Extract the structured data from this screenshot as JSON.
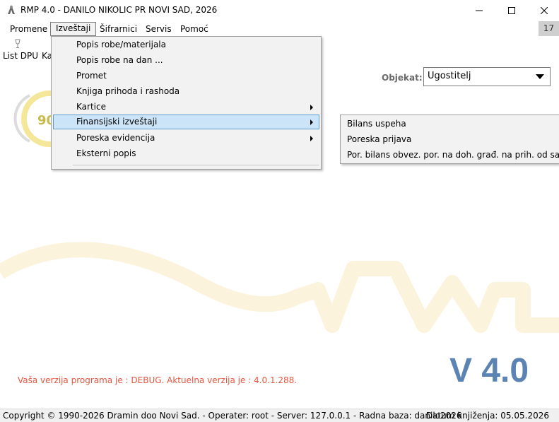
{
  "window": {
    "title": "RMP 4.0 - DANILO NIKOLIC PR NOVI SAD, 2026",
    "minimize_icon": "minimize-icon",
    "maximize_icon": "maximize-icon",
    "close_icon": "close-icon"
  },
  "menubar": {
    "items": [
      "Promene",
      "Izveštaji",
      "Šifrarnici",
      "Servis",
      "Pomoć"
    ],
    "active": "Izveštaji",
    "count": "17"
  },
  "toolbar": {
    "labels": [
      "List DPU",
      "Ka"
    ]
  },
  "objekat": {
    "label": "Objekat:",
    "value": "Ugostitelj"
  },
  "dropdown": {
    "items": [
      {
        "label": "Popis robe/materijala",
        "submenu": false
      },
      {
        "label": "Popis robe na dan ...",
        "submenu": false
      },
      {
        "label": "Promet",
        "submenu": false
      },
      {
        "label": "Knjiga prihoda i rashoda",
        "submenu": false
      },
      {
        "label": "Kartice",
        "submenu": true
      },
      {
        "label": "Finansijski izveštaji",
        "submenu": true,
        "highlighted": true
      },
      {
        "label": "Poreska evidencija",
        "submenu": true
      },
      {
        "label": "Eksterni popis",
        "submenu": false
      }
    ]
  },
  "submenu": {
    "items": [
      "Bilans uspeha",
      "Poreska prijava",
      "Por. bilans obvez. por. na doh. građ. na prih. od sam. delat."
    ]
  },
  "background": {
    "logo_text": "90"
  },
  "version": {
    "message": "Vaša verzija programa je : DEBUG. Aktuelna verzija je : 4.0.1.288.",
    "big_label": "V 4.0"
  },
  "status": {
    "left": "Copyright © 1990-2026 Dramin doo Novi Sad. - Operater: root - Server: 127.0.0.1 - Radna baza: danilo2026",
    "right": "Datum knjiženja: 05.05.2026"
  },
  "colors": {
    "accent_blue": "#5b84b4",
    "message_red": "#e8553d",
    "highlight": "#cce4f7",
    "watermark": "#fcf3dc"
  }
}
